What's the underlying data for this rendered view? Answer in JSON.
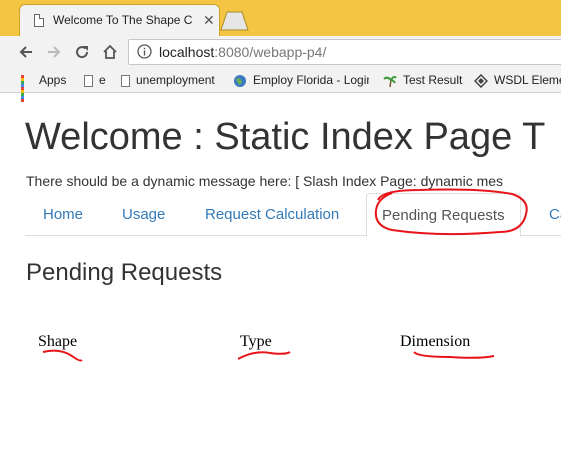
{
  "browser": {
    "tab_title": "Welcome To The Shape C",
    "url_host": "localhost",
    "url_rest": ":8080/webapp-p4/",
    "bookmarks": [
      {
        "label": "Apps",
        "icon": "apps-grid-icon"
      },
      {
        "label": "e",
        "icon": "page-icon"
      },
      {
        "label": "unemployment",
        "icon": "page-icon"
      },
      {
        "label": "Employ Florida - Login",
        "icon": "globe-icon"
      },
      {
        "label": "Test Result",
        "icon": "palm-tree-icon"
      },
      {
        "label": "WSDL Eleme",
        "icon": "diamond-icon"
      }
    ]
  },
  "page": {
    "heading": "Welcome : Static Index Page T",
    "dynamic_message": "There should be a dynamic message here: [ Slash Index Page: dynamic mes",
    "nav_tabs": [
      {
        "label": "Home",
        "active": false
      },
      {
        "label": "Usage",
        "active": false
      },
      {
        "label": "Request Calculation",
        "active": false
      },
      {
        "label": "Pending Requests",
        "active": true
      },
      {
        "label": "Ca",
        "active": false
      }
    ],
    "section_title": "Pending Requests",
    "table_headers": [
      "Shape",
      "Type",
      "Dimension"
    ]
  },
  "colors": {
    "tab_strip": "#f4c542",
    "link": "#337ab7",
    "annotation_ink": "#e8141a"
  }
}
